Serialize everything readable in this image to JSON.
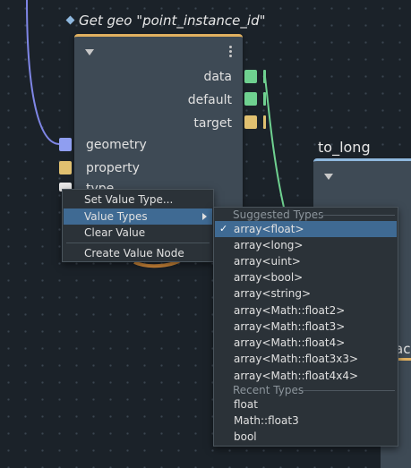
{
  "node": {
    "title": "Get geo \"point_instance_id\"",
    "header_color": "#e0b060",
    "outputs": [
      {
        "label": "data",
        "color": "#6fd190"
      },
      {
        "label": "default",
        "color": "#6fd190"
      },
      {
        "label": "target",
        "color": "#e0c070"
      }
    ],
    "inputs": [
      {
        "label": "geometry",
        "color": "#8f9ef0"
      },
      {
        "label": "property",
        "color": "#e0c070"
      },
      {
        "label": "type",
        "color": "#e8e8e8"
      }
    ]
  },
  "node2": {
    "title": "to_long",
    "header_color": "#8fb8de"
  },
  "node3": {
    "title_fragment": "ac"
  },
  "context_menu": {
    "items": [
      {
        "label": "Set Value Type..."
      },
      {
        "label": "Value Types",
        "has_submenu": true,
        "active": true
      },
      {
        "label": "Clear Value"
      },
      {
        "label": "Create Value Node"
      }
    ]
  },
  "submenu": {
    "suggested_header": "Suggested Types",
    "suggested": [
      {
        "label": "array<float>",
        "checked": true,
        "active": true
      },
      {
        "label": "array<long>"
      },
      {
        "label": "array<uint>"
      },
      {
        "label": "array<bool>"
      },
      {
        "label": "array<string>"
      },
      {
        "label": "array<Math::float2>"
      },
      {
        "label": "array<Math::float3>"
      },
      {
        "label": "array<Math::float4>"
      },
      {
        "label": "array<Math::float3x3>"
      },
      {
        "label": "array<Math::float4x4>"
      }
    ],
    "recent_header": "Recent Types",
    "recent": [
      {
        "label": "float"
      },
      {
        "label": "Math::float3"
      },
      {
        "label": "bool"
      }
    ],
    "check_glyph": "✓"
  },
  "colors": {
    "selection": "#3f6a93",
    "wire_blue": "#7f86e6",
    "wire_green": "#6fd190",
    "wire_orange": "#d28a3a"
  }
}
